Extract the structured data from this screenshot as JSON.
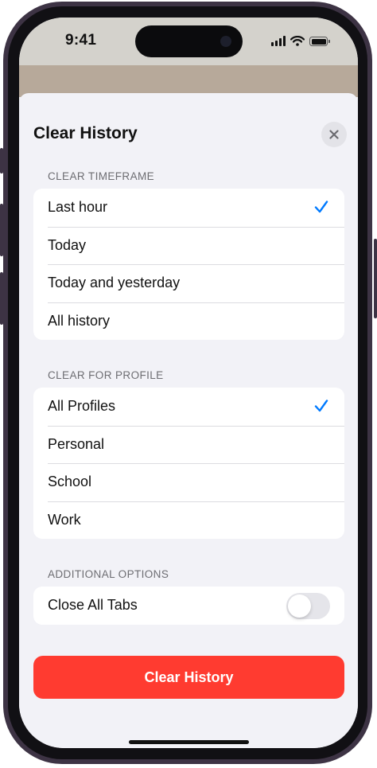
{
  "status_bar": {
    "time": "9:41"
  },
  "sheet": {
    "title": "Clear History",
    "close_icon": "xmark-icon"
  },
  "sections": {
    "timeframe": {
      "header": "CLEAR TIMEFRAME",
      "options": [
        "Last hour",
        "Today",
        "Today and yesterday",
        "All history"
      ],
      "selected": "Last hour"
    },
    "profile": {
      "header": "CLEAR FOR PROFILE",
      "options": [
        "All Profiles",
        "Personal",
        "School",
        "Work"
      ],
      "selected": "All Profiles"
    },
    "additional": {
      "header": "ADDITIONAL OPTIONS",
      "close_all_tabs": {
        "label": "Close All Tabs",
        "enabled": false
      }
    }
  },
  "actions": {
    "clear_history": "Clear History"
  },
  "colors": {
    "accent": "#007aff",
    "destructive": "#ff3b30",
    "background": "#f2f2f7",
    "frame": "#3d3344"
  }
}
